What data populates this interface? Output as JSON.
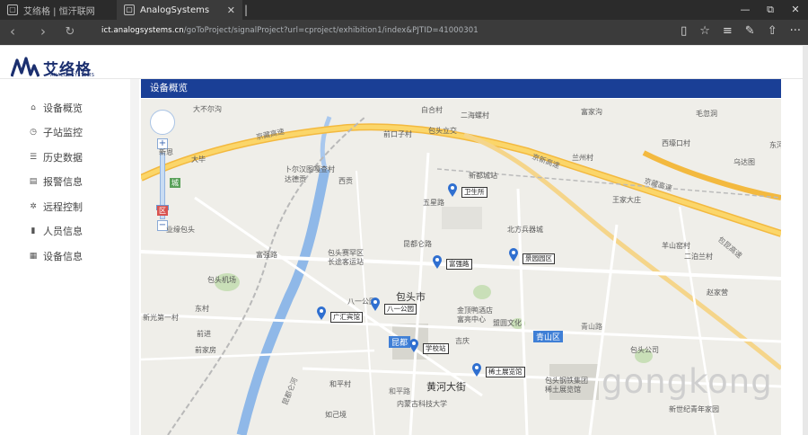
{
  "browser": {
    "tabs": [
      {
        "label": "艾络格 | 恒汗联网",
        "active": false
      },
      {
        "label": "AnalogSystems",
        "active": true
      }
    ],
    "new_tab_label": "|",
    "window_controls": [
      "—",
      "⧉",
      "✕"
    ],
    "url_host": "ict.analogsystems.cn",
    "url_path": "/goToProject/signalProject?url=cproject/exhibition1/index&PJTID=41000301"
  },
  "brand": {
    "name_cn": "艾络格",
    "name_en": "ANALOGSYSTEMS"
  },
  "sidebar": {
    "items": [
      {
        "icon": "home-icon",
        "glyph": "⌂",
        "label": "设备概览"
      },
      {
        "icon": "clock-icon",
        "glyph": "◷",
        "label": "子站监控"
      },
      {
        "icon": "list-icon",
        "glyph": "☰",
        "label": "历史数据"
      },
      {
        "icon": "info-icon",
        "glyph": "▤",
        "label": "报警信息"
      },
      {
        "icon": "gear-icon",
        "glyph": "✲",
        "label": "远程控制"
      },
      {
        "icon": "bookmark-icon",
        "glyph": "▮",
        "label": "人员信息"
      },
      {
        "icon": "grid-icon",
        "glyph": "▦",
        "label": "设备信息"
      }
    ]
  },
  "panel": {
    "title": "设备概览"
  },
  "map": {
    "city_label": "包头市",
    "district_label": "青山区",
    "district2_label": "昆都",
    "markers": [
      {
        "label": "卫生所"
      },
      {
        "label": "富强路"
      },
      {
        "label": "景园园区"
      },
      {
        "label": "广汇宾馆"
      },
      {
        "label": "八一公园"
      },
      {
        "label": "学校站"
      },
      {
        "label": "稀土展览馆"
      }
    ],
    "places": [
      "大不尔沟",
      "白合村",
      "二海螺村",
      "富家沟",
      "毛忽洞",
      "前口子村",
      "包头立交",
      "西壕口村",
      "兰州村",
      "东河",
      "大毕",
      "新都城站",
      "王家大庄",
      "卜尔汉图嘎查村",
      "达德贡",
      "西贡",
      "五星路",
      "北方兵器城",
      "新恩",
      "乌达图",
      "业缘包头",
      "昆都仑路",
      "包头赛罕区",
      "长途客运站",
      "富强路",
      "二泊兰村",
      "羊山窑村",
      "包头机场",
      "赵家营",
      "八一公园",
      "金顶鸭酒店",
      "富亮中心",
      "东村",
      "新光第一村",
      "前进",
      "吉庆",
      "盟圆文化",
      "包头钢铁集团",
      "稀土展览馆",
      "前家房",
      "包头公司",
      "和平村",
      "黄河大街",
      "内蒙古科技大学",
      "如己境",
      "新世纪青年家园"
    ],
    "road_labels": [
      "京藏高速",
      "京新高速",
      "京藏高速",
      "包昆高速",
      "昆都仑河",
      "和平路",
      "青山路"
    ],
    "zoom_labels": [
      "+",
      "−",
      "城",
      "区"
    ]
  },
  "watermark": "gongkong"
}
